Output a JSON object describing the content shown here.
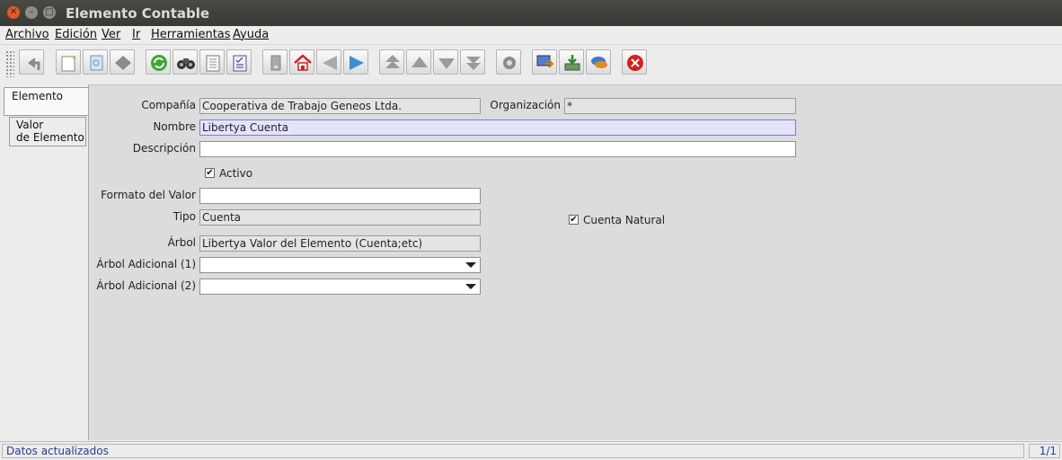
{
  "window": {
    "title": "Elemento Contable"
  },
  "menu": [
    "Archivo",
    "Edición",
    "Ver",
    "Ir",
    "Herramientas",
    "Ayuda"
  ],
  "toolbar_icons": [
    "undo-icon",
    "new-record-icon",
    "copy-record-icon",
    "delete-record-icon",
    "refresh-icon",
    "find-icon",
    "attachment-icon",
    "report-icon",
    "history-icon",
    "home-icon",
    "previous-icon",
    "next-icon",
    "first-record-icon",
    "previous-record-icon",
    "next-record-icon",
    "last-record-icon",
    "workflow-icon",
    "zoom-across-icon",
    "archive-icon",
    "chat-icon",
    "close-window-icon"
  ],
  "tabs": [
    "Elemento",
    "Valor\nde Elemento"
  ],
  "form": {
    "compania": {
      "label": "Compañía",
      "value": "Cooperativa de Trabajo Geneos Ltda."
    },
    "organizacion": {
      "label": "Organización",
      "value": "*"
    },
    "nombre": {
      "label": "Nombre",
      "value": "Libertya Cuenta"
    },
    "descripcion": {
      "label": "Descripción",
      "value": ""
    },
    "activo": {
      "label": "Activo",
      "checked": true
    },
    "formato": {
      "label": "Formato del Valor",
      "value": ""
    },
    "tipo": {
      "label": "Tipo",
      "value": "Cuenta"
    },
    "cuenta_natural": {
      "label": "Cuenta Natural",
      "checked": true
    },
    "arbol": {
      "label": "Árbol",
      "value": "Libertya Valor del Elemento (Cuenta;etc)"
    },
    "arbol1": {
      "label": "Árbol Adicional (1)",
      "value": ""
    },
    "arbol2": {
      "label": "Árbol Adicional (2)",
      "value": ""
    }
  },
  "status": {
    "message": "Datos actualizados",
    "page": "1/1"
  }
}
